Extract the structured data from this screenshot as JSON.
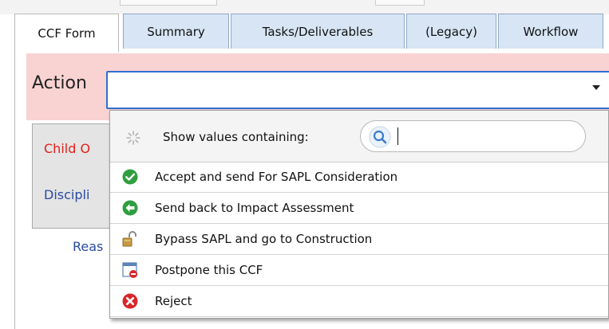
{
  "tabs": [
    {
      "label": "CCF Form"
    },
    {
      "label": "Summary"
    },
    {
      "label": "Tasks/Deliverables"
    },
    {
      "label": "(Legacy)"
    },
    {
      "label": "Workflow"
    }
  ],
  "form": {
    "action_label": "Action",
    "action_value": "",
    "child_label": "Child O",
    "discipline_label": "Discipli",
    "reason_label": "Reas"
  },
  "dropdown": {
    "search_label": "Show values containing:",
    "search_value": "",
    "options": [
      {
        "label": "Accept and send For SAPL Consideration",
        "icon": "check-icon",
        "color": "#2f9e3f"
      },
      {
        "label": "Send back to Impact Assessment",
        "icon": "back-arrow-icon",
        "color": "#2f9e3f"
      },
      {
        "label": "Bypass SAPL and go to Construction",
        "icon": "unlocked-padlock-icon",
        "color": "#c79a45"
      },
      {
        "label": "Postpone this CCF",
        "icon": "calendar-blocked-icon",
        "color": "#d9262b"
      },
      {
        "label": "Reject",
        "icon": "x-circle-icon",
        "color": "#d9262b"
      }
    ]
  },
  "colors": {
    "action_band": "#f9d2d2",
    "tab_background": "#d7e5f5",
    "select_border": "#2e6fce",
    "required_label": "#e0201b",
    "field_label": "#2a4aa0"
  }
}
